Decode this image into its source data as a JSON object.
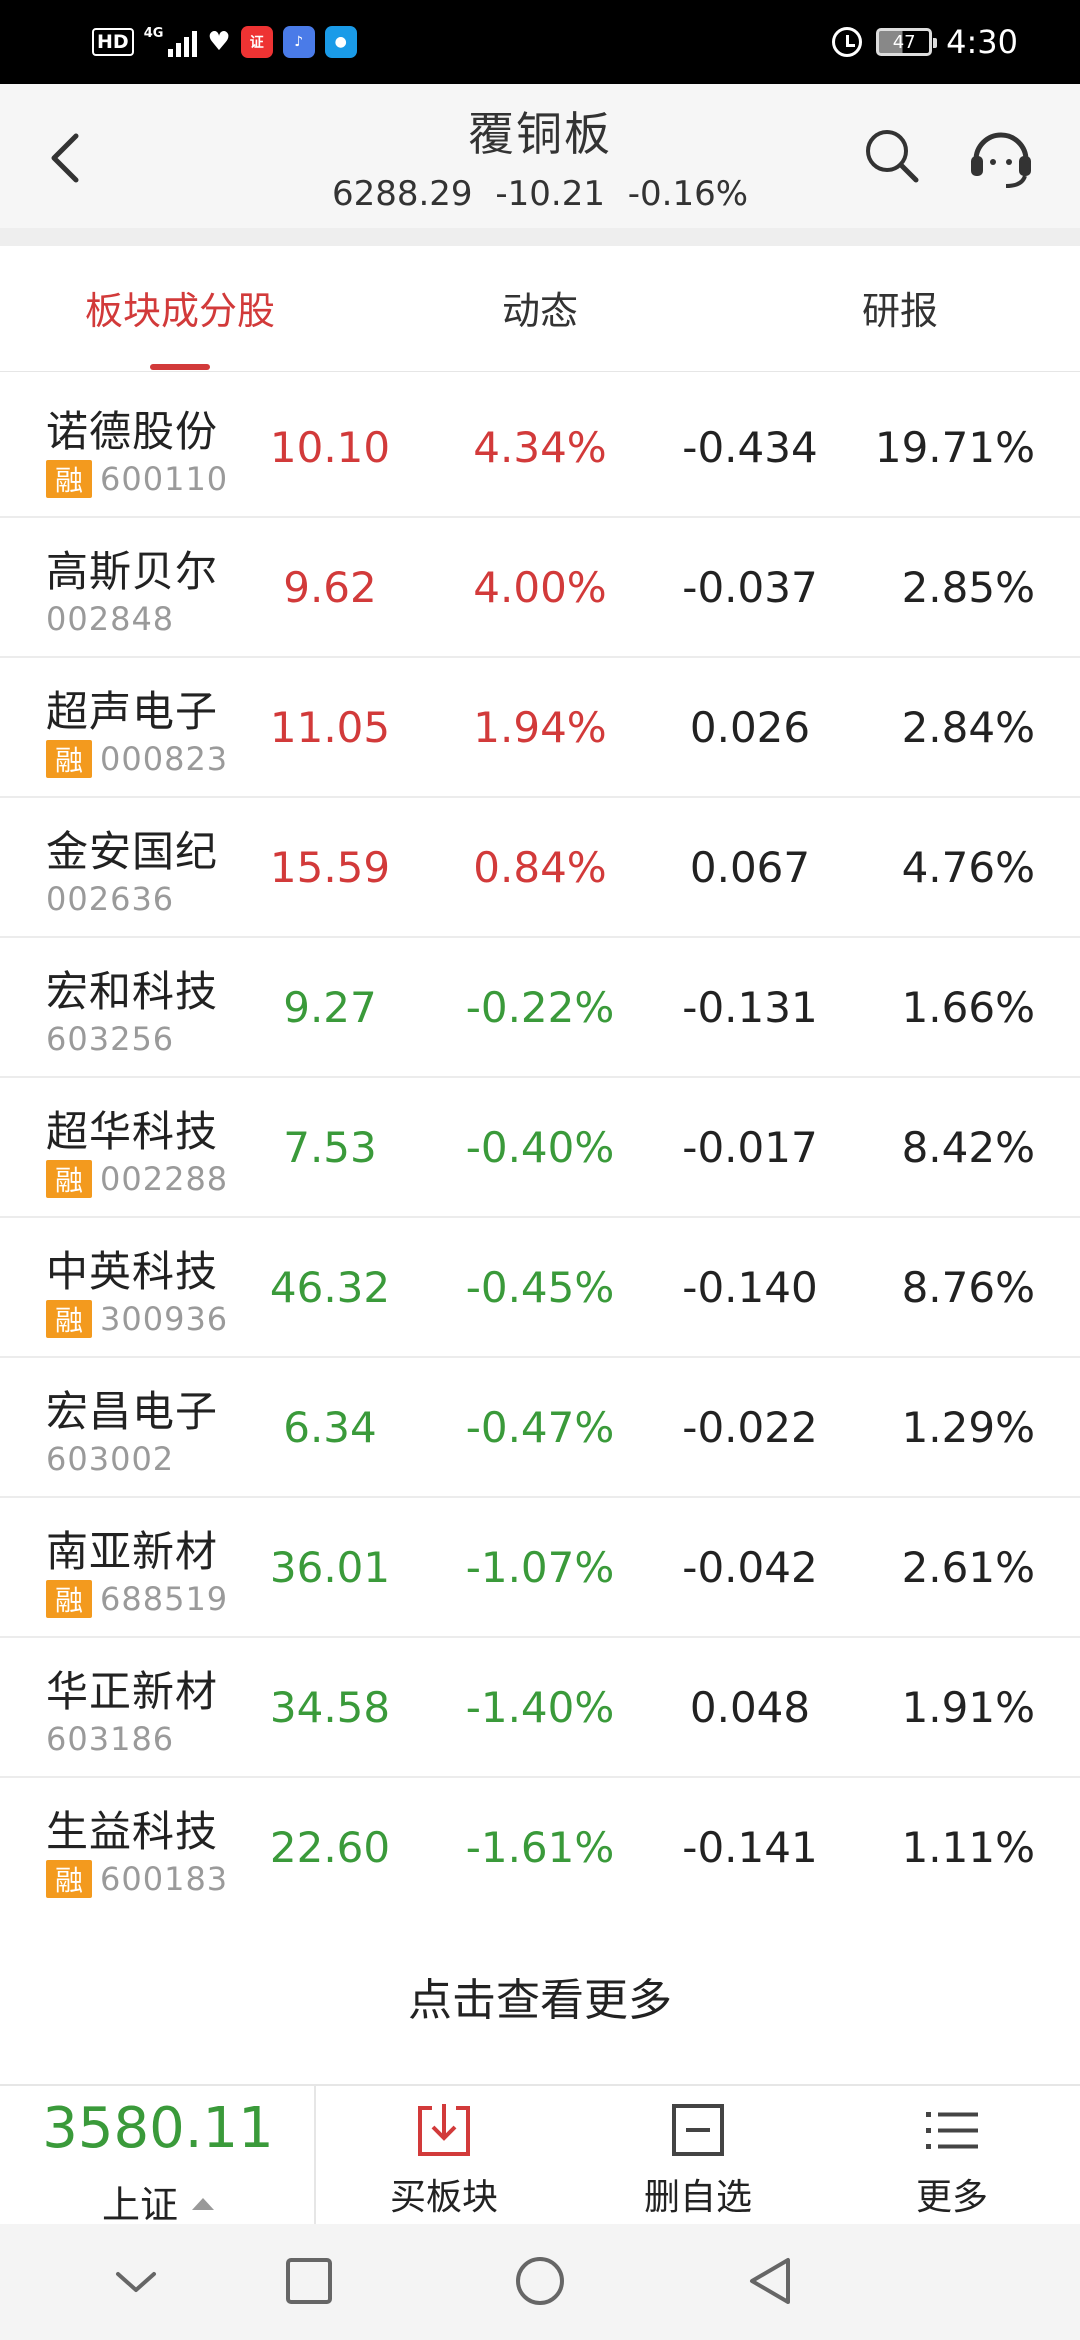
{
  "status_bar": {
    "network": "4G",
    "battery": "47",
    "time": "4:30"
  },
  "header": {
    "title": "覆铜板",
    "price": "6288.29",
    "change": "-10.21",
    "change_pct": "-0.16%"
  },
  "tabs": [
    {
      "label": "板块成分股",
      "active": true
    },
    {
      "label": "动态",
      "active": false
    },
    {
      "label": "研报",
      "active": false
    }
  ],
  "stocks": [
    {
      "name": "诺德股份",
      "code": "600110",
      "margin": true,
      "price": "10.10",
      "change": "4.34%",
      "speed": "-0.434",
      "ratio": "19.71%",
      "dir": "up"
    },
    {
      "name": "高斯贝尔",
      "code": "002848",
      "margin": false,
      "price": "9.62",
      "change": "4.00%",
      "speed": "-0.037",
      "ratio": "2.85%",
      "dir": "up"
    },
    {
      "name": "超声电子",
      "code": "000823",
      "margin": true,
      "price": "11.05",
      "change": "1.94%",
      "speed": "0.026",
      "ratio": "2.84%",
      "dir": "up"
    },
    {
      "name": "金安国纪",
      "code": "002636",
      "margin": false,
      "price": "15.59",
      "change": "0.84%",
      "speed": "0.067",
      "ratio": "4.76%",
      "dir": "up"
    },
    {
      "name": "宏和科技",
      "code": "603256",
      "margin": false,
      "price": "9.27",
      "change": "-0.22%",
      "speed": "-0.131",
      "ratio": "1.66%",
      "dir": "down"
    },
    {
      "name": "超华科技",
      "code": "002288",
      "margin": true,
      "price": "7.53",
      "change": "-0.40%",
      "speed": "-0.017",
      "ratio": "8.42%",
      "dir": "down"
    },
    {
      "name": "中英科技",
      "code": "300936",
      "margin": true,
      "price": "46.32",
      "change": "-0.45%",
      "speed": "-0.140",
      "ratio": "8.76%",
      "dir": "down"
    },
    {
      "name": "宏昌电子",
      "code": "603002",
      "margin": false,
      "price": "6.34",
      "change": "-0.47%",
      "speed": "-0.022",
      "ratio": "1.29%",
      "dir": "down"
    },
    {
      "name": "南亚新材",
      "code": "688519",
      "margin": true,
      "price": "36.01",
      "change": "-1.07%",
      "speed": "-0.042",
      "ratio": "2.61%",
      "dir": "down"
    },
    {
      "name": "华正新材",
      "code": "603186",
      "margin": false,
      "price": "34.58",
      "change": "-1.40%",
      "speed": "0.048",
      "ratio": "1.91%",
      "dir": "down"
    },
    {
      "name": "生益科技",
      "code": "600183",
      "margin": true,
      "price": "22.60",
      "change": "-1.61%",
      "speed": "-0.141",
      "ratio": "1.11%",
      "dir": "down"
    }
  ],
  "margin_badge": "融",
  "more_label": "点击查看更多",
  "toolbar": {
    "index_value": "3580.11",
    "index_name": "上证",
    "buy_label": "买板块",
    "remove_label": "删自选",
    "more_label": "更多"
  },
  "colors": {
    "up": "#d23a3a",
    "down": "#3a9a3a",
    "accent": "#d23a3a",
    "margin_badge": "#f39a1e"
  }
}
